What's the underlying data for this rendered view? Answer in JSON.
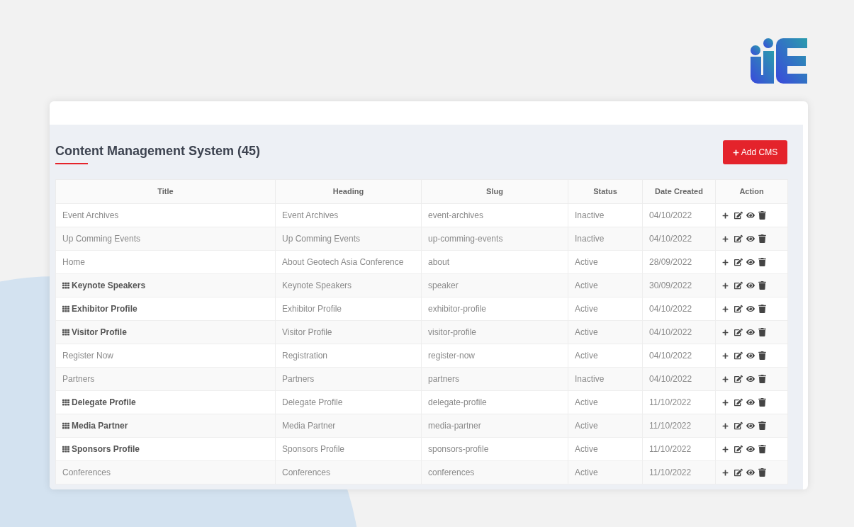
{
  "header": {
    "title": "Content Management System (45)",
    "add_button": "Add CMS"
  },
  "table": {
    "columns": [
      "Title",
      "Heading",
      "Slug",
      "Status",
      "Date Created",
      "Action"
    ],
    "rows": [
      {
        "title": "Event Archives",
        "kind": "page",
        "heading": "Event Archives",
        "slug": "event-archives",
        "status": "Inactive",
        "date_created": "04/10/2022"
      },
      {
        "title": "Up Comming Events",
        "kind": "page",
        "heading": "Up Comming Events",
        "slug": "up-comming-events",
        "status": "Inactive",
        "date_created": "04/10/2022"
      },
      {
        "title": "Home",
        "kind": "page",
        "heading": "About Geotech Asia Conference",
        "slug": "about",
        "status": "Active",
        "date_created": "28/09/2022"
      },
      {
        "title": "Keynote Speakers",
        "kind": "section",
        "heading": "Keynote Speakers",
        "slug": "speaker",
        "status": "Active",
        "date_created": "30/09/2022"
      },
      {
        "title": "Exhibitor Profile",
        "kind": "section",
        "heading": "Exhibitor Profile",
        "slug": "exhibitor-profile",
        "status": "Active",
        "date_created": "04/10/2022"
      },
      {
        "title": "Visitor Profile",
        "kind": "section",
        "heading": "Visitor Profile",
        "slug": "visitor-profile",
        "status": "Active",
        "date_created": "04/10/2022"
      },
      {
        "title": "Register Now",
        "kind": "page",
        "heading": "Registration",
        "slug": "register-now",
        "status": "Active",
        "date_created": "04/10/2022"
      },
      {
        "title": "Partners",
        "kind": "page",
        "heading": "Partners",
        "slug": "partners",
        "status": "Inactive",
        "date_created": "04/10/2022"
      },
      {
        "title": "Delegate Profile",
        "kind": "section",
        "heading": "Delegate Profile",
        "slug": "delegate-profile",
        "status": "Active",
        "date_created": "11/10/2022"
      },
      {
        "title": "Media Partner",
        "kind": "section",
        "heading": "Media Partner",
        "slug": "media-partner",
        "status": "Active",
        "date_created": "11/10/2022"
      },
      {
        "title": "Sponsors Profile",
        "kind": "section",
        "heading": "Sponsors Profile",
        "slug": "sponsors-profile",
        "status": "Active",
        "date_created": "11/10/2022"
      },
      {
        "title": "Conferences",
        "kind": "page",
        "heading": "Conferences",
        "slug": "conferences",
        "status": "Active",
        "date_created": "11/10/2022"
      }
    ]
  }
}
